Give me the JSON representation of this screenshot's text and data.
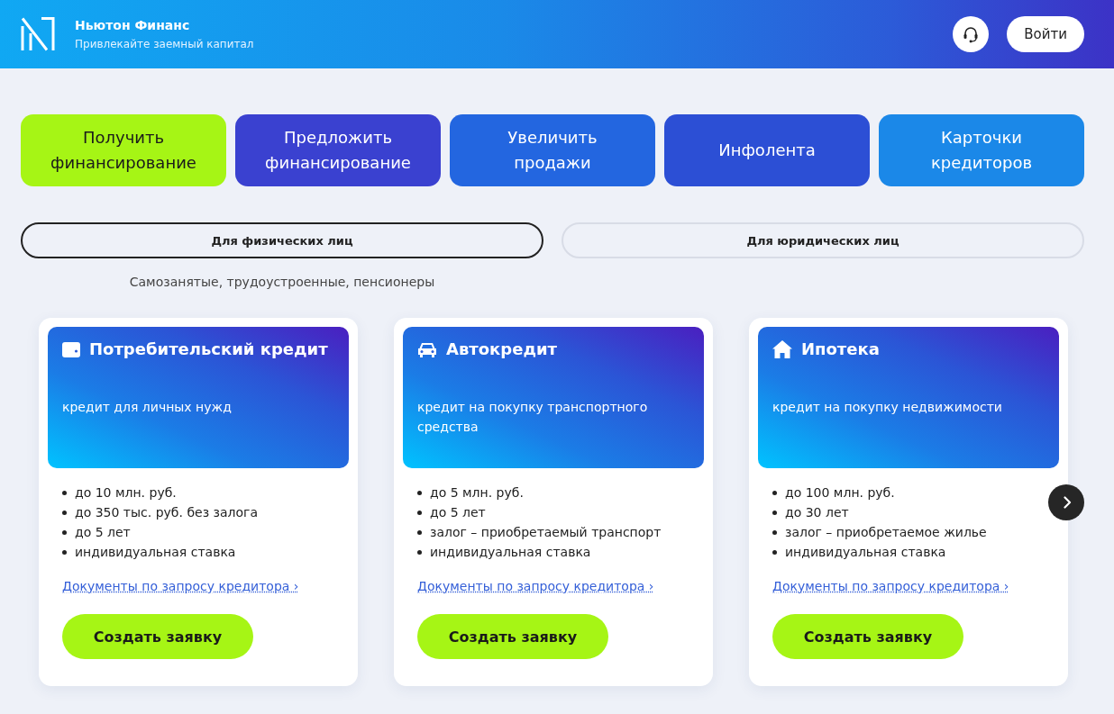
{
  "header": {
    "brand": {
      "title": "Ньютон Финанс",
      "subtitle": "Привлекайте заемный капитал"
    },
    "login_button": "Войти"
  },
  "nav_tiles": [
    {
      "label": "Получить финансирование",
      "selected": true,
      "color": "#a6f515"
    },
    {
      "label": "Предложить финансирование",
      "selected": false,
      "color": "#3a41d0"
    },
    {
      "label": "Увеличить продажи",
      "selected": false,
      "color": "#2366e0"
    },
    {
      "label": "Инфолента",
      "selected": false,
      "color": "#2c4fd5"
    },
    {
      "label": "Карточки кредиторов",
      "selected": false,
      "color": "#1b88e8"
    }
  ],
  "audience_tabs": [
    {
      "label": "Для физических лиц",
      "selected": true
    },
    {
      "label": "Для юридических лиц",
      "selected": false
    }
  ],
  "audience_note": "Самозанятые, трудоустроенные, пенсионеры",
  "products": [
    {
      "kind": "wallet",
      "title": "Потребительский кредит",
      "description": "кредит для личных нужд",
      "features": [
        "до 10 млн. руб.",
        "до 350 тыс. руб. без залога",
        "до 5 лет",
        "индивидуальная ставка"
      ],
      "documents_link": "Документы по запросу кредитора ›",
      "button": "Создать заявку"
    },
    {
      "kind": "car",
      "title": "Автокредит",
      "description": "кредит на покупку транспортного средства",
      "features": [
        "до 5 млн. руб.",
        "до 5 лет",
        "залог – приобретаемый транспорт",
        "индивидуальная ставка"
      ],
      "documents_link": "Документы по запросу кредитора ›",
      "button": "Создать заявку"
    },
    {
      "kind": "house",
      "title": "Ипотека",
      "description": "кредит на покупку недвижимости",
      "features": [
        "до 100 млн. руб.",
        "до 30 лет",
        "залог – приобретаемое жилье",
        "индивидуальная ставка"
      ],
      "documents_link": "Документы по запросу кредитора ›",
      "button": "Создать заявку"
    }
  ]
}
